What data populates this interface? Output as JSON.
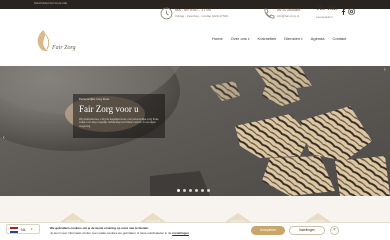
{
  "topbar": {
    "text": "Scroll down for more info"
  },
  "header": {
    "logo_text": "Fair Zorg",
    "hours": {
      "line1": "Ma - do 9:00 - 17:00",
      "line2": "Vrijdag - zaterdag - zondag GESLOTEN"
    },
    "phone": {
      "line1": "06 47285485",
      "line2": "info@fair-zorg.nl"
    },
    "brand": {
      "title": "The Title",
      "subtitle": "Leeuwarden"
    }
  },
  "nav": {
    "items": [
      {
        "label": "Home",
        "caret": ""
      },
      {
        "label": "Over ons",
        "caret": "▾"
      },
      {
        "label": "Kosmetiek",
        "caret": ""
      },
      {
        "label": "Diensten",
        "caret": "▾"
      },
      {
        "label": "Agenda",
        "caret": ""
      },
      {
        "label": "Contact",
        "caret": ""
      }
    ]
  },
  "hero": {
    "kicker": "Persoonlijke zorg thuis",
    "title": "Fair Zorg voor u",
    "body": "Wij ondersteunen u bij het dagelijks leven met persoonlijke zorg thuis, zodat u zo lang mogelijk zelfstandig kunt blijven wonen in uw eigen omgeving.",
    "arrow_left": "‹",
    "arrow_right": "›",
    "slide_count": 6,
    "active_slide": 0
  },
  "cookie": {
    "lang": "NL",
    "line1": "We gebruiken cookies om je de beste ervaring op onze site te bieden.",
    "line2": "Je kunt meer informatie vinden over welke cookies we gebruiken of deze uitschakelen in de",
    "link": "instellingen",
    "accept": "Accepteren",
    "settings": "Instellingen",
    "close": "×"
  },
  "colors": {
    "accent": "#c9a66b",
    "text_dark": "#3a3028",
    "topbar": "#2a2420"
  },
  "icons": [
    "clock-icon",
    "phone-icon",
    "facebook-icon",
    "instagram-icon",
    "netherlands-flag-icon"
  ]
}
